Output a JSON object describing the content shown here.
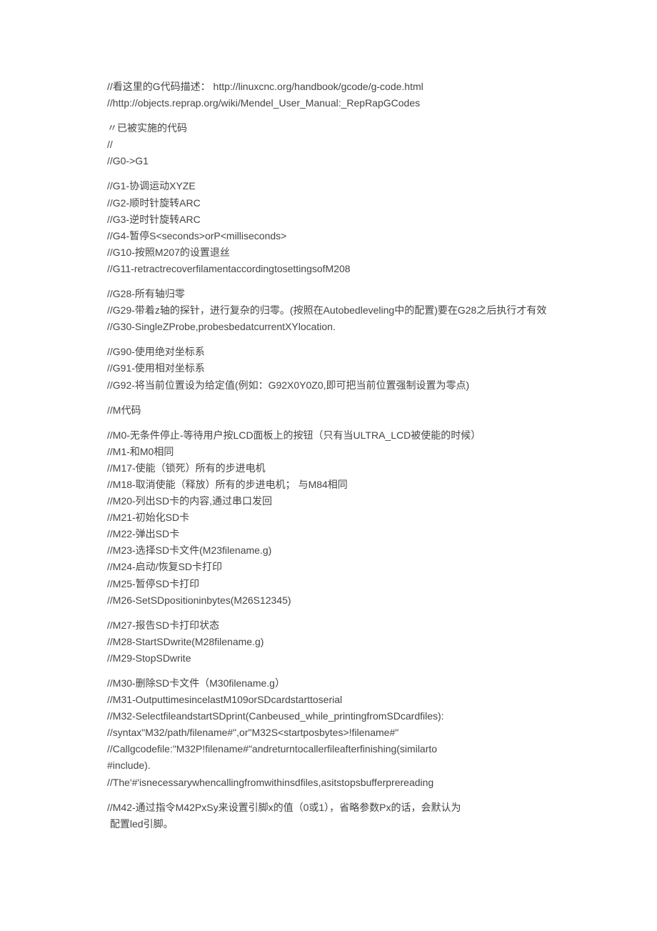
{
  "blocks": [
    {
      "lines": [
        "//看这里的G代码描述： http://linuxcnc.org/handbook/gcode/g-code.html",
        "//http://objects.reprap.org/wiki/Mendel_User_Manual:_RepRapGCodes"
      ]
    },
    {
      "lines": [
        "〃已被实施的代码",
        "//",
        "//G0->G1"
      ]
    },
    {
      "lines": [
        "//G1-协调运动XYZE",
        "//G2-顺时针旋转ARC",
        "//G3-逆时针旋转ARC",
        "//G4-暂停S<seconds>orP<milliseconds>",
        "//G10-按照M207的设置退丝",
        "//G11-retractrecoverfilamentaccordingtosettingsofM208"
      ]
    },
    {
      "lines": [
        "//G28-所有轴归零",
        "//G29-带着z轴的探针，进行复杂的归零。(按照在Autobedleveling中的配置)要在G28之后执行才有效",
        "//G30-SingleZProbe,probesbedatcurrentXYlocation."
      ]
    },
    {
      "lines": [
        "//G90-使用绝对坐标系",
        "//G91-使用相对坐标系",
        "//G92-将当前位置设为给定值(例如：G92X0Y0Z0,即可把当前位置强制设置为零点)"
      ]
    },
    {
      "lines": [
        "//M代码"
      ]
    },
    {
      "lines": [
        "//M0-无条件停止-等待用户按LCD面板上的按钮（只有当ULTRA_LCD被使能的时候）",
        "//M1-和M0相同",
        "//M17-使能（锁死）所有的步进电机",
        "//M18-取消使能（释放）所有的步进电机； 与M84相同",
        "//M20-列出SD卡的内容,通过串口发回",
        "//M21-初始化SD卡",
        "//M22-弹出SD卡",
        "//M23-选择SD卡文件(M23filename.g)",
        "//M24-启动/恢复SD卡打印",
        "//M25-暂停SD卡打印",
        "//M26-SetSDpositioninbytes(M26S12345)"
      ]
    },
    {
      "lines": [
        "//M27-报告SD卡打印状态",
        "//M28-StartSDwrite(M28filename.g)",
        "//M29-StopSDwrite"
      ]
    },
    {
      "lines": [
        "//M30-删除SD卡文件（M30filename.g）",
        "//M31-OutputtimesincelastM109orSDcardstarttoserial",
        "//M32-SelectfileandstartSDprint(Canbeused_while_printingfromSDcardfiles):",
        "//syntax\"M32/path/filename#\",or\"M32S<startposbytes>!filename#\"",
        "//Callgcodefile:\"M32P!filename#\"andreturntocallerfileafterfinishing(similarto",
        "#include).",
        "//The'#'isnecessarywhencallingfromwithinsdfiles,asitstopsbufferprereading"
      ]
    },
    {
      "lines": [
        "//M42-通过指令M42PxSy来设置引脚x的值（0或1），省略参数Px的话，会默认为",
        " 配置led引脚。"
      ]
    }
  ]
}
